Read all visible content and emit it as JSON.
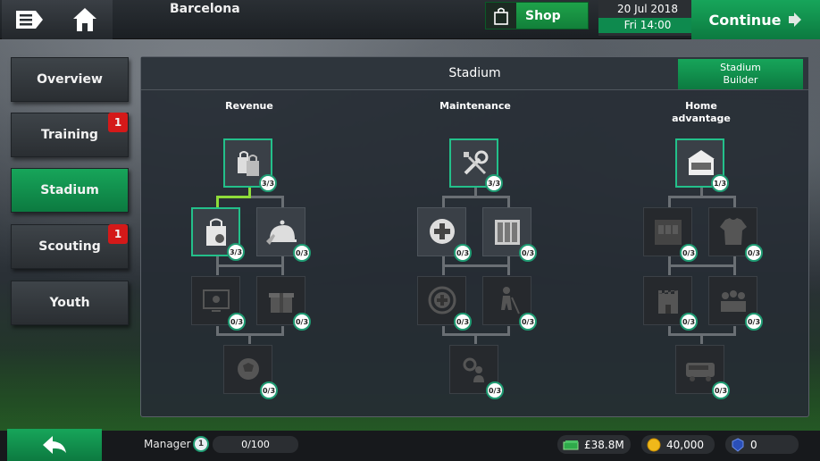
{
  "header": {
    "club_name": "Barcelona",
    "shop_label": "Shop",
    "date": "20 Jul 2018",
    "time": "Fri 14:00",
    "continue_label": "Continue"
  },
  "nav": [
    {
      "label": "Overview",
      "badge": ""
    },
    {
      "label": "Training",
      "badge": "1"
    },
    {
      "label": "Stadium",
      "badge": ""
    },
    {
      "label": "Scouting",
      "badge": "1"
    },
    {
      "label": "Youth",
      "badge": ""
    }
  ],
  "panel": {
    "title": "Stadium",
    "builder_label_1": "Stadium",
    "builder_label_2": "Builder",
    "columns": [
      {
        "title_1": "Revenue",
        "title_2": ""
      },
      {
        "title_1": "Maintenance",
        "title_2": ""
      },
      {
        "title_1": "Home",
        "title_2": "advantage"
      }
    ],
    "nodes": [
      {
        "count": "3/3",
        "icon": "shopping-bags-icon"
      },
      {
        "count": "3/3",
        "icon": "shopping-bag-icon"
      },
      {
        "count": "0/3",
        "icon": "food-service-icon"
      },
      {
        "count": "0/3",
        "icon": "screen-icon"
      },
      {
        "count": "0/3",
        "icon": "gift-icon"
      },
      {
        "count": "0/3",
        "icon": "ball-icon"
      },
      {
        "count": "3/3",
        "icon": "wrench-screwdriver-icon"
      },
      {
        "count": "0/3",
        "icon": "medical-cross-icon"
      },
      {
        "count": "0/3",
        "icon": "locker-icon"
      },
      {
        "count": "0/3",
        "icon": "medical-laurel-icon"
      },
      {
        "count": "0/3",
        "icon": "groundskeeper-icon"
      },
      {
        "count": "0/3",
        "icon": "gear-person-icon"
      },
      {
        "count": "1/3",
        "icon": "stadium-icon"
      },
      {
        "count": "0/3",
        "icon": "dressing-room-icon"
      },
      {
        "count": "0/3",
        "icon": "jersey-icon"
      },
      {
        "count": "0/3",
        "icon": "castle-icon"
      },
      {
        "count": "0/3",
        "icon": "fans-icon"
      },
      {
        "count": "0/3",
        "icon": "bus-icon"
      }
    ]
  },
  "footer": {
    "manager_label": "Manager",
    "manager_level": "1",
    "xp": "0/100",
    "cash": "£38.8M",
    "coins": "40,000",
    "tokens": "0"
  }
}
